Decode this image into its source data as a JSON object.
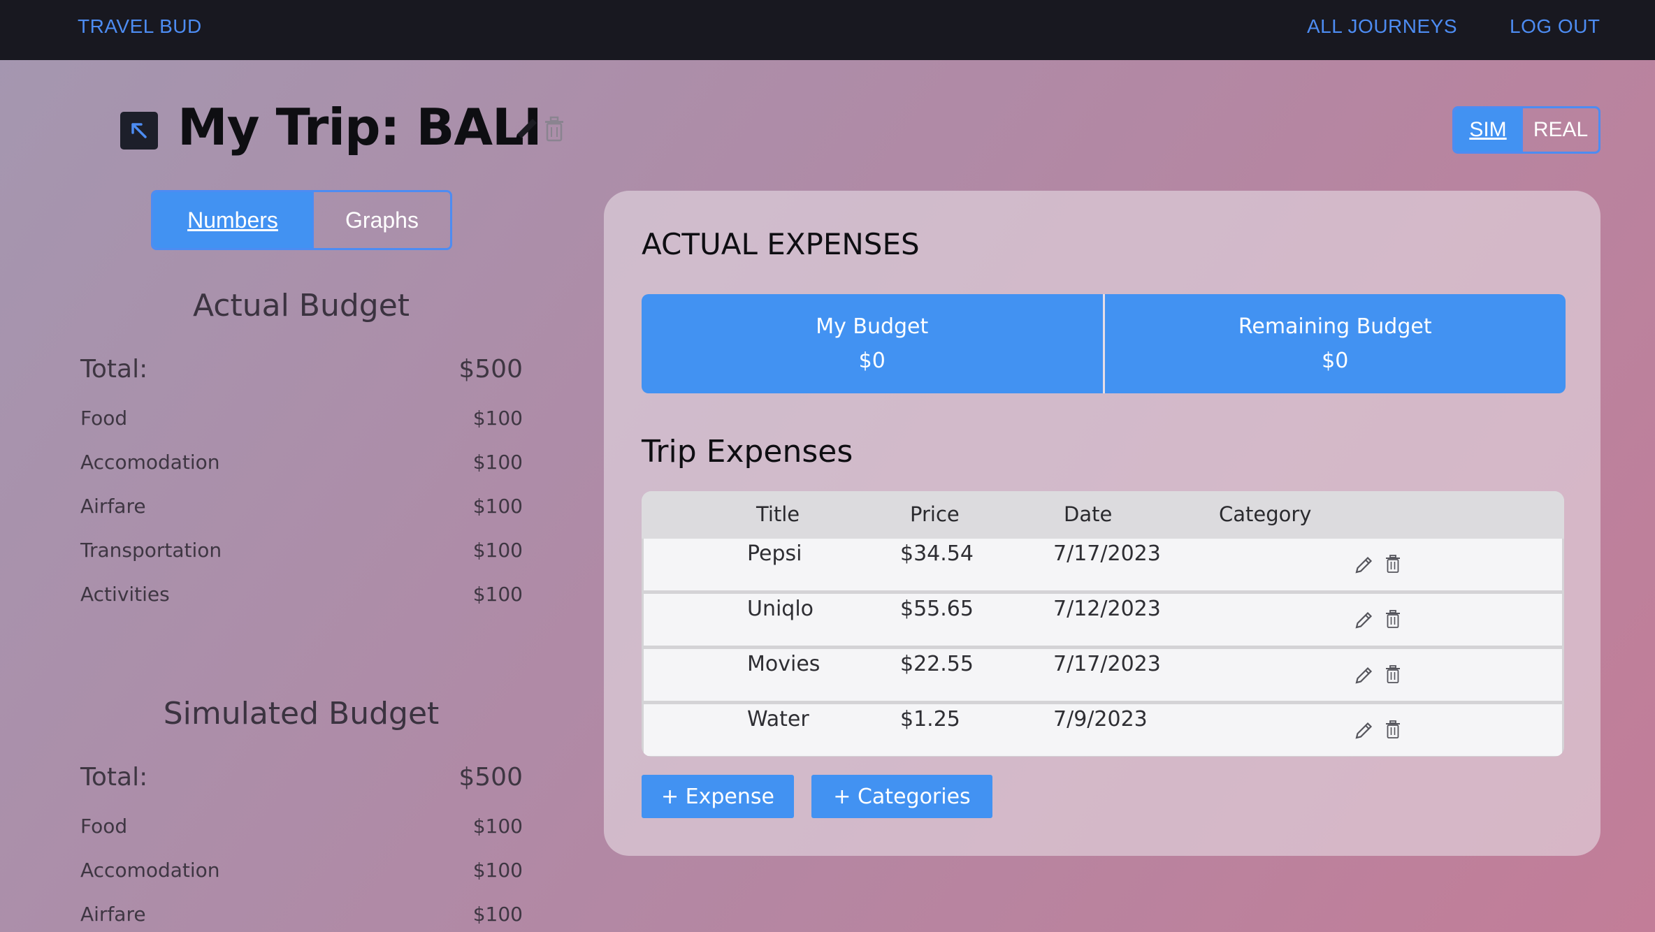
{
  "nav": {
    "brand": "TRAVEL BUD",
    "all_journeys": "ALL JOURNEYS",
    "log_out": "LOG OUT"
  },
  "trip": {
    "title": "My Trip: BALI"
  },
  "mode_toggle": {
    "sim": "SIM",
    "real": "REAL",
    "selected": "SIM"
  },
  "view_toggle": {
    "numbers": "Numbers",
    "graphs": "Graphs",
    "selected": "Numbers"
  },
  "actual_budget": {
    "heading": "Actual Budget",
    "total_label": "Total:",
    "total_value": "$500",
    "items": [
      {
        "label": "Food",
        "value": "$100"
      },
      {
        "label": "Accomodation",
        "value": "$100"
      },
      {
        "label": "Airfare",
        "value": "$100"
      },
      {
        "label": "Transportation",
        "value": "$100"
      },
      {
        "label": "Activities",
        "value": "$100"
      }
    ]
  },
  "simulated_budget": {
    "heading": "Simulated Budget",
    "total_label": "Total:",
    "total_value": "$500",
    "items": [
      {
        "label": "Food",
        "value": "$100"
      },
      {
        "label": "Accomodation",
        "value": "$100"
      },
      {
        "label": "Airfare",
        "value": "$100"
      }
    ]
  },
  "expenses_panel": {
    "title": "ACTUAL EXPENSES",
    "my_budget_label": "My Budget",
    "my_budget_value": "$0",
    "remaining_label": "Remaining Budget",
    "remaining_value": "$0",
    "trip_expenses_title": "Trip Expenses",
    "columns": [
      "Title",
      "Price",
      "Date",
      "Category"
    ],
    "rows": [
      {
        "title": "Pepsi",
        "price": "$34.54",
        "date": "7/17/2023",
        "category": ""
      },
      {
        "title": "Uniqlo",
        "price": "$55.65",
        "date": "7/12/2023",
        "category": ""
      },
      {
        "title": "Movies",
        "price": "$22.55",
        "date": "7/17/2023",
        "category": ""
      },
      {
        "title": "Water",
        "price": "$1.25",
        "date": "7/9/2023",
        "category": ""
      }
    ],
    "add_expense": "+ Expense",
    "add_categories": "+ Categories"
  },
  "icons": {
    "back": "arrow-up-left-icon",
    "edit": "pencil-icon",
    "delete": "trash-icon"
  },
  "colors": {
    "accent": "#4292f2",
    "nav_bg": "#181820",
    "nav_link": "#4d8cf2"
  }
}
